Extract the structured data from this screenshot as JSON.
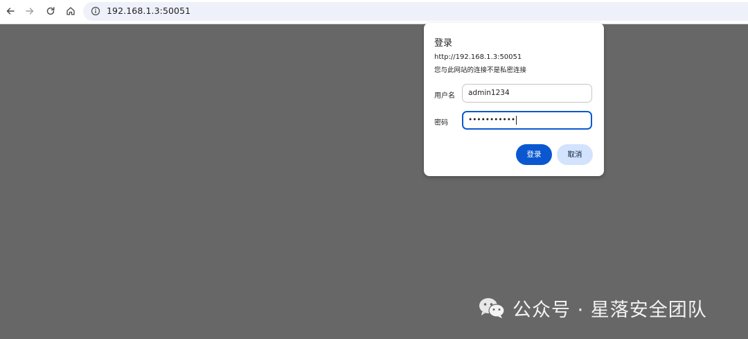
{
  "browser": {
    "url": "192.168.1.3:50051",
    "icons": [
      "back-arrow-icon",
      "forward-arrow-icon",
      "reload-icon",
      "home-icon",
      "info-icon"
    ]
  },
  "dialog": {
    "title": "登录",
    "url": "http://192.168.1.3:50051",
    "warning": "您与此网站的连接不是私密连接",
    "username_label": "用户名",
    "username_value": "admin1234",
    "password_label": "密码",
    "password_value": "•••••••••••",
    "login_button": "登录",
    "cancel_button": "取消"
  },
  "watermark": {
    "text": "公众号 · 星落安全团队",
    "icon": "wechat-icon"
  },
  "colors": {
    "background": "#676767",
    "primary": "#0b57d0",
    "secondary_button": "#d3e3fd",
    "omnibox": "#eef1f9"
  }
}
